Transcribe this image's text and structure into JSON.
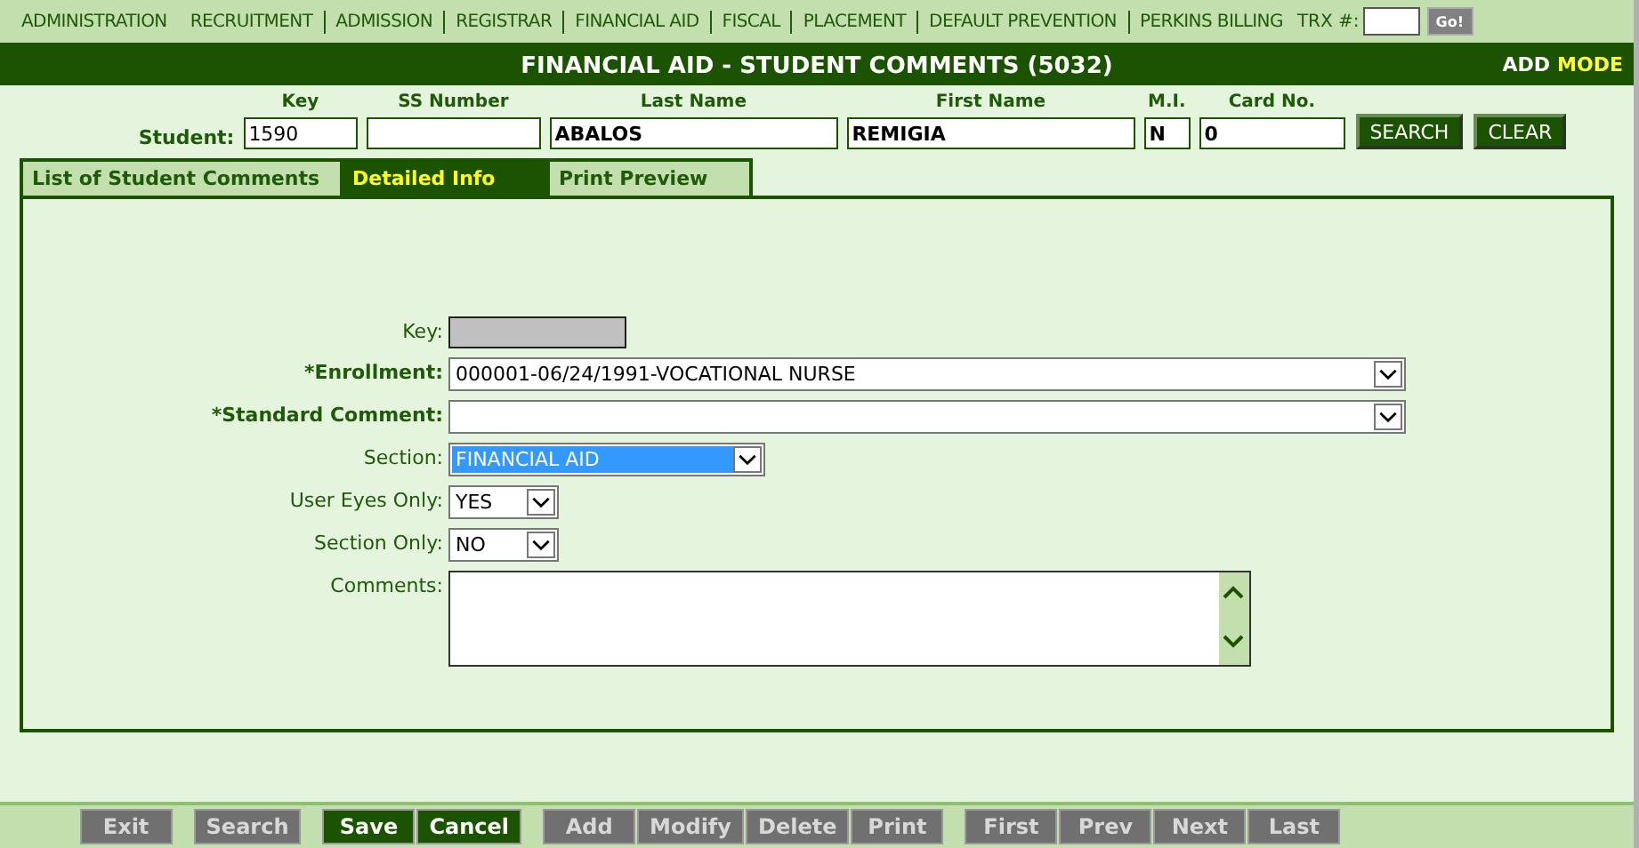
{
  "menu": {
    "items": [
      {
        "label": "ADMINISTRATION"
      },
      {
        "label": "RECRUITMENT"
      },
      {
        "label": "ADMISSION"
      },
      {
        "label": "REGISTRAR"
      },
      {
        "label": "FINANCIAL AID"
      },
      {
        "label": "FISCAL"
      },
      {
        "label": "PLACEMENT"
      },
      {
        "label": "DEFAULT PREVENTION"
      },
      {
        "label": "PERKINS BILLING"
      }
    ],
    "trx_label": "TRX #:",
    "go_button": "Go!"
  },
  "title_bar": {
    "title": "FINANCIAL AID - STUDENT COMMENTS (5032)",
    "mode_value": "ADD",
    "mode_label": "MODE"
  },
  "student": {
    "label": "Student:",
    "fields": [
      {
        "heading": "Key",
        "value": "1590",
        "bold": false
      },
      {
        "heading": "SS Number"
      },
      {
        "heading": "Last Name",
        "value": "ABALOS",
        "bold": true
      },
      {
        "heading": "First Name",
        "value": "REMIGIA",
        "bold": true
      },
      {
        "heading": "M.I.",
        "value": "N",
        "bold": true
      },
      {
        "heading": "Card No.",
        "value": "0",
        "bold": true
      }
    ],
    "buttons": [
      "SEARCH",
      "CLEAR"
    ]
  },
  "tabs": [
    {
      "label": "List of Student Comments",
      "selected": false
    },
    {
      "label": "Detailed Info",
      "selected": true
    },
    {
      "label": "Print Preview",
      "selected": false
    }
  ],
  "form": [
    {
      "kind": "readonly",
      "label": "Key:",
      "required": false
    },
    {
      "kind": "select",
      "label": "*Enrollment:",
      "required": true,
      "value": "000001-06/24/1991-VOCATIONAL NURSE"
    },
    {
      "kind": "select",
      "label": "*Standard Comment:",
      "required": true
    },
    {
      "kind": "select",
      "label": "Section:",
      "required": false,
      "value": "FINANCIAL AID",
      "highlighted": true
    },
    {
      "kind": "select",
      "label": "User Eyes Only:",
      "required": false,
      "value": "YES"
    },
    {
      "kind": "select",
      "label": "Section Only:",
      "required": false,
      "value": "NO"
    },
    {
      "kind": "textarea",
      "label": "Comments:",
      "required": false
    }
  ],
  "toolbar": [
    [
      {
        "label": "Exit",
        "disabled": true
      }
    ],
    [
      {
        "label": "Search",
        "disabled": true
      }
    ],
    [
      {
        "label": "Save",
        "disabled": false
      },
      {
        "label": "Cancel",
        "disabled": false
      }
    ],
    [
      {
        "label": "Add",
        "disabled": true
      },
      {
        "label": "Modify",
        "disabled": true
      },
      {
        "label": "Delete",
        "disabled": true
      },
      {
        "label": "Print",
        "disabled": true
      }
    ],
    [
      {
        "label": "First",
        "disabled": true
      },
      {
        "label": "Prev",
        "disabled": true
      },
      {
        "label": "Next",
        "disabled": true
      },
      {
        "label": "Last",
        "disabled": true
      }
    ]
  ]
}
